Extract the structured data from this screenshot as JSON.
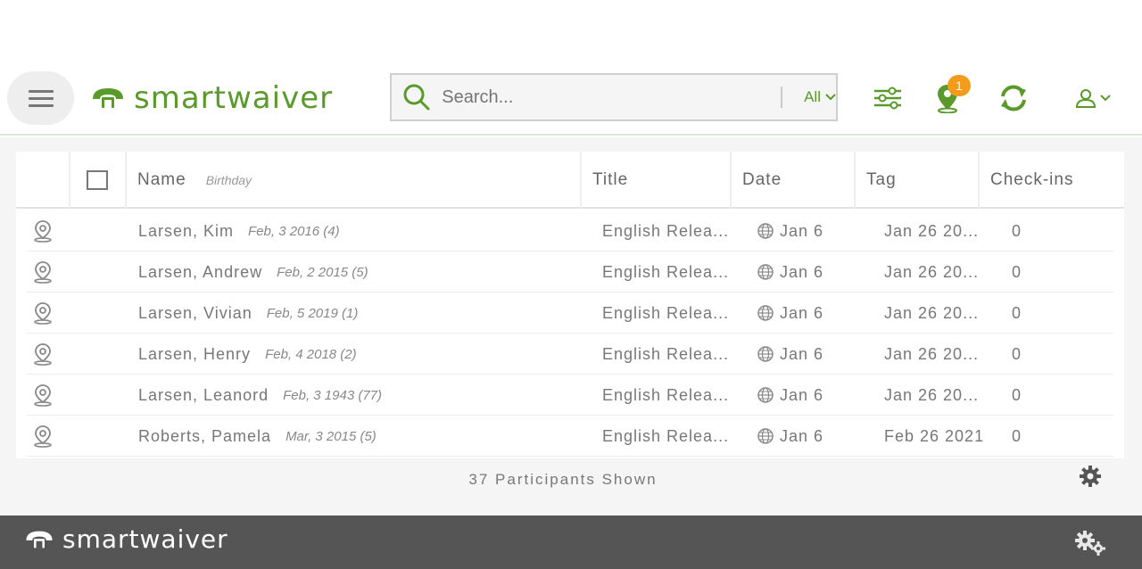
{
  "header": {
    "logo_text": "smartwaiver",
    "search": {
      "placeholder": "Search...",
      "scope": "All"
    },
    "notification_count": "1"
  },
  "table": {
    "columns": {
      "name": "Name",
      "birthday": "Birthday",
      "title": "Title",
      "date": "Date",
      "tag": "Tag",
      "checkins": "Check-ins"
    },
    "rows": [
      {
        "name": "Larsen, Kim",
        "birthday": "Feb, 3 2016 (4)",
        "title": "English Relea...",
        "date": "Jan 6",
        "tag": "Jan 26 20...",
        "checkins": "0"
      },
      {
        "name": "Larsen, Andrew",
        "birthday": "Feb, 2 2015 (5)",
        "title": "English Relea...",
        "date": "Jan 6",
        "tag": "Jan 26 20...",
        "checkins": "0"
      },
      {
        "name": "Larsen, Vivian",
        "birthday": "Feb, 5 2019 (1)",
        "title": "English Relea...",
        "date": "Jan 6",
        "tag": "Jan 26 20...",
        "checkins": "0"
      },
      {
        "name": "Larsen, Henry",
        "birthday": "Feb, 4 2018 (2)",
        "title": "English Relea...",
        "date": "Jan 6",
        "tag": "Jan 26 20...",
        "checkins": "0"
      },
      {
        "name": "Larsen, Leanord",
        "birthday": "Feb, 3 1943 (77)",
        "title": "English Relea...",
        "date": "Jan 6",
        "tag": "Jan 26 20...",
        "checkins": "0"
      },
      {
        "name": "Roberts, Pamela",
        "birthday": "Mar, 3 2015 (5)",
        "title": "English Relea...",
        "date": "Jan 6",
        "tag": "Feb 26 2021",
        "checkins": "0"
      }
    ],
    "footer_text": "37 Participants Shown"
  },
  "footer": {
    "logo_text": "smartwaiver"
  },
  "colors": {
    "brand_green": "#5a9a2a",
    "badge_orange": "#f39c1c",
    "footer_bg": "#555555"
  }
}
